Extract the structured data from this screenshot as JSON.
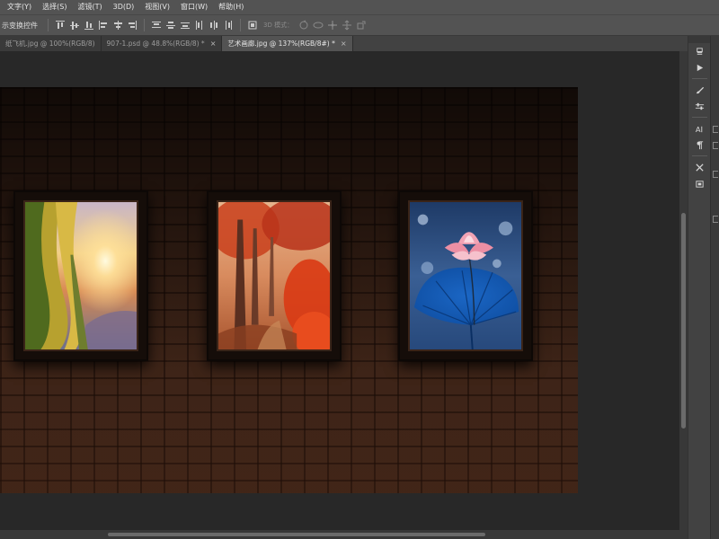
{
  "menu": [
    "文字(Y)",
    "选择(S)",
    "滤镜(T)",
    "3D(D)",
    "视图(V)",
    "窗口(W)",
    "帮助(H)"
  ],
  "options": {
    "transform_label": "示变换控件",
    "mode_3d_label": "3D 模式："
  },
  "tabs": [
    {
      "label": "纸飞机.jpg @ 100%(RGB/8)",
      "active": false,
      "closable": false
    },
    {
      "label": "907-1.psd @ 48.8%(RGB/8) *",
      "active": false,
      "closable": true
    },
    {
      "label": "艺术画廊.jpg @ 137%(RGB/8#) *",
      "active": true,
      "closable": true
    }
  ],
  "artworks": [
    "sunset-hills-photo",
    "autumn-forest-photo",
    "lotus-leaf-photo"
  ],
  "colors": {
    "ui_panel": "#535353",
    "ui_dark": "#282828",
    "brick": "#7a4a30",
    "frame": "#150d09"
  }
}
